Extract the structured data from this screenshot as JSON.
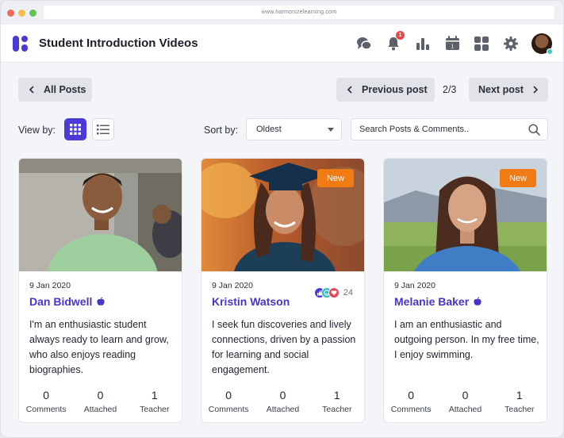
{
  "browser": {
    "url": "www.harmonizelearning.com"
  },
  "header": {
    "title": "Student Introduction Videos",
    "notification_count": "1",
    "icons": [
      "chat-icon",
      "bell-icon",
      "bar-chart-icon",
      "calendar-icon",
      "apps-grid-icon",
      "gear-icon"
    ],
    "brand_color": "#4b3bd6"
  },
  "nav": {
    "all_posts": "All Posts",
    "previous_post": "Previous post",
    "next_post": "Next post",
    "pager": "2/3"
  },
  "controls": {
    "view_by_label": "View by:",
    "sort_by_label": "Sort by:",
    "sort_value": "Oldest",
    "search_placeholder": "Search Posts & Comments.."
  },
  "cards": [
    {
      "date": "9 Jan 2020",
      "name": "Dan Bidwell",
      "is_new": false,
      "description": "I'm an enthusiastic student always ready to learn and grow, who also enjoys reading biographies.",
      "stats": [
        {
          "value": "0",
          "label": "Comments"
        },
        {
          "value": "0",
          "label": "Attached"
        },
        {
          "value": "1",
          "label": "Teacher"
        }
      ]
    },
    {
      "date": "9 Jan 2020",
      "name": "Kristin Watson",
      "is_new": true,
      "new_label": "New",
      "reaction_count": "24",
      "description": "I seek fun discoveries and lively connections, driven by a passion for learning and social engagement.",
      "stats": [
        {
          "value": "0",
          "label": "Comments"
        },
        {
          "value": "0",
          "label": "Attached"
        },
        {
          "value": "1",
          "label": "Teacher"
        }
      ]
    },
    {
      "date": "9 Jan 2020",
      "name": "Melanie Baker",
      "is_new": true,
      "new_label": "New",
      "description": "I am an enthusiastic and outgoing person. In my free time, I enjoy swimming.",
      "stats": [
        {
          "value": "0",
          "label": "Comments"
        },
        {
          "value": "0",
          "label": "Attached"
        },
        {
          "value": "1",
          "label": "Teacher"
        }
      ]
    }
  ]
}
